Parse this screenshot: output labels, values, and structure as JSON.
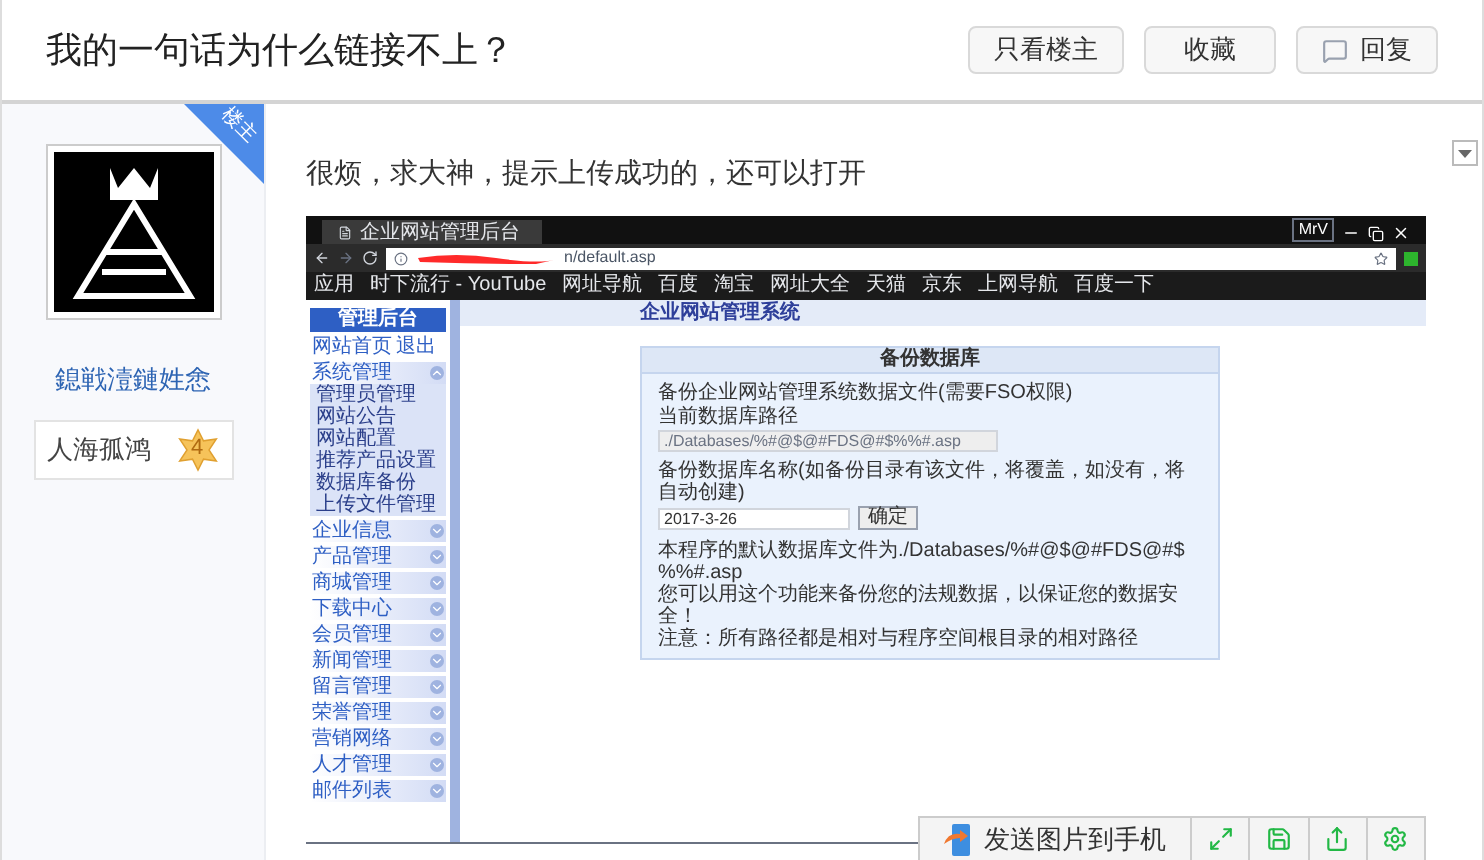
{
  "title": "我的一句话为什么链接不上？",
  "header_buttons": [
    {
      "kind": "text",
      "label": "只看楼主"
    },
    {
      "kind": "text",
      "label": "收藏"
    },
    {
      "kind": "reply",
      "label": "回复"
    }
  ],
  "author": {
    "badge": "楼主",
    "name": "鎴戦潱鏈姓悆",
    "rank": "人海孤鸿",
    "level": "4"
  },
  "post": {
    "text": "很烦，求大神，提示上传成功的，还可以打开",
    "screenshot": {
      "tab_title": "企业网站管理后台",
      "url": "n/default.asp",
      "user": "MrV",
      "bookmarks": [
        "应用",
        "时下流行 - YouTube",
        "网址导航",
        "百度",
        "淘宝",
        "网址大全",
        "天猫",
        "京东",
        "上网导航",
        "百度一下"
      ],
      "sidebar_title": "管理后台",
      "sidebar_links": [
        "网站首页",
        "退出"
      ],
      "groups": [
        {
          "label": "系统管理",
          "expanded": true,
          "children": [
            "管理员管理",
            "网站公告",
            "网站配置",
            "推荐产品设置",
            "数据库备份",
            "上传文件管理"
          ]
        },
        {
          "label": "企业信息",
          "expanded": false
        },
        {
          "label": "产品管理",
          "expanded": false
        },
        {
          "label": "商城管理",
          "expanded": false
        },
        {
          "label": "下载中心",
          "expanded": false
        },
        {
          "label": "会员管理",
          "expanded": false
        },
        {
          "label": "新闻管理",
          "expanded": false
        },
        {
          "label": "留言管理",
          "expanded": false
        },
        {
          "label": "荣誉管理",
          "expanded": false
        },
        {
          "label": "营销网络",
          "expanded": false
        },
        {
          "label": "人才管理",
          "expanded": false
        },
        {
          "label": "邮件列表",
          "expanded": false
        }
      ],
      "header": "企业网站管理系统",
      "panel": {
        "title": "备份数据库",
        "heading": "备份企业网站管理系统数据文件(需要FSO权限)",
        "path_label": "当前数据库路径",
        "path_value": "./Databases/%#@$@#FDS@#$%%#.asp",
        "name_label": "备份数据库名称(如备份目录有该文件，将覆盖，如没有，将自动创建)",
        "name_value": "2017-3-26",
        "submit": "确定",
        "notes": [
          "本程序的默认数据库文件为./Databases/%#@$@#FDS@#$%%#.asp",
          "您可以用这个功能来备份您的法规数据，以保证您的数据安全！",
          "注意：所有路径都是相对与程序空间根目录的相对路径"
        ]
      }
    }
  },
  "image_toolbar": {
    "send_label": "发送图片到手机"
  }
}
